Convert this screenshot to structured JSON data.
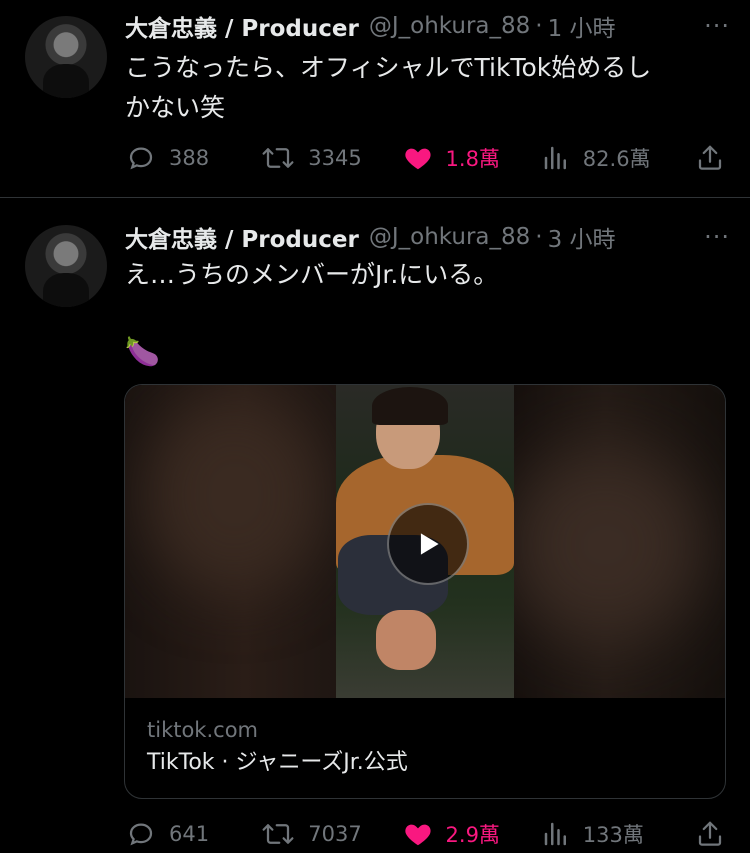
{
  "tweets": [
    {
      "author_name": "大倉忠義 / Producer",
      "handle": "@J_ohkura_88",
      "time": "1 小時",
      "text_lines": [
        "こうなったら、オフィシャルでTikTok始めるし",
        "かない笑"
      ],
      "replies": "388",
      "retweets": "3345",
      "likes": "1.8萬",
      "views": "82.6萬"
    },
    {
      "author_name": "大倉忠義 / Producer",
      "handle": "@J_ohkura_88",
      "time": "3 小時",
      "text_lines": [
        "え…うちのメンバーがJr.にいる。"
      ],
      "emoji": "🍆",
      "card_domain": "tiktok.com",
      "card_title": "TikTok · ジャニーズJr.公式",
      "replies": "641",
      "retweets": "7037",
      "likes": "2.9萬",
      "views": "133萬"
    }
  ],
  "icons": {
    "reply": "reply-icon",
    "retweet": "retweet-icon",
    "like": "heart-icon",
    "views": "views-icon",
    "share": "share-icon",
    "more": "more-icon",
    "play": "play-icon"
  },
  "colors": {
    "background": "#000000",
    "text": "#e7e9ea",
    "muted": "#71767b",
    "like": "#f91880",
    "divider": "#2f3336"
  },
  "more_label": "···"
}
